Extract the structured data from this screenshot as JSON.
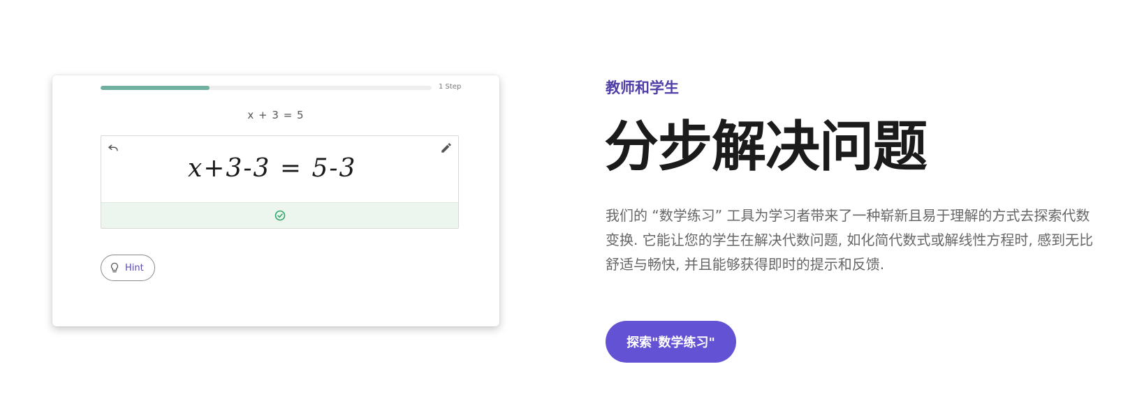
{
  "practice_card": {
    "progress": {
      "fraction": 0.33,
      "label": "1 Step",
      "color": "#6fb0a0"
    },
    "problem": "x + 3  =  5",
    "work": {
      "handwritten_step": "x+3-3 = 5-3",
      "undo_icon": "undo-icon",
      "edit_icon": "pencil-icon",
      "status_icon": "check-circle-icon",
      "status_color": "#2fa56a"
    },
    "hint_button": {
      "icon": "lightbulb-icon",
      "label": "Hint"
    }
  },
  "content": {
    "eyebrow": "教师和学生",
    "headline": "分步解决问题",
    "description": "我们的 “数学练习” 工具为学习者带来了一种崭新且易于理解的方式去探索代数变换. 它能让您的学生在解决代数问题, 如化简代数式或解线性方程时, 感到无比舒适与畅快, 并且能够获得即时的提示和反馈.",
    "cta_label": "探索\"数学练习\"",
    "accent_color": "#6452d4",
    "eyebrow_color": "#4f3ea8"
  }
}
